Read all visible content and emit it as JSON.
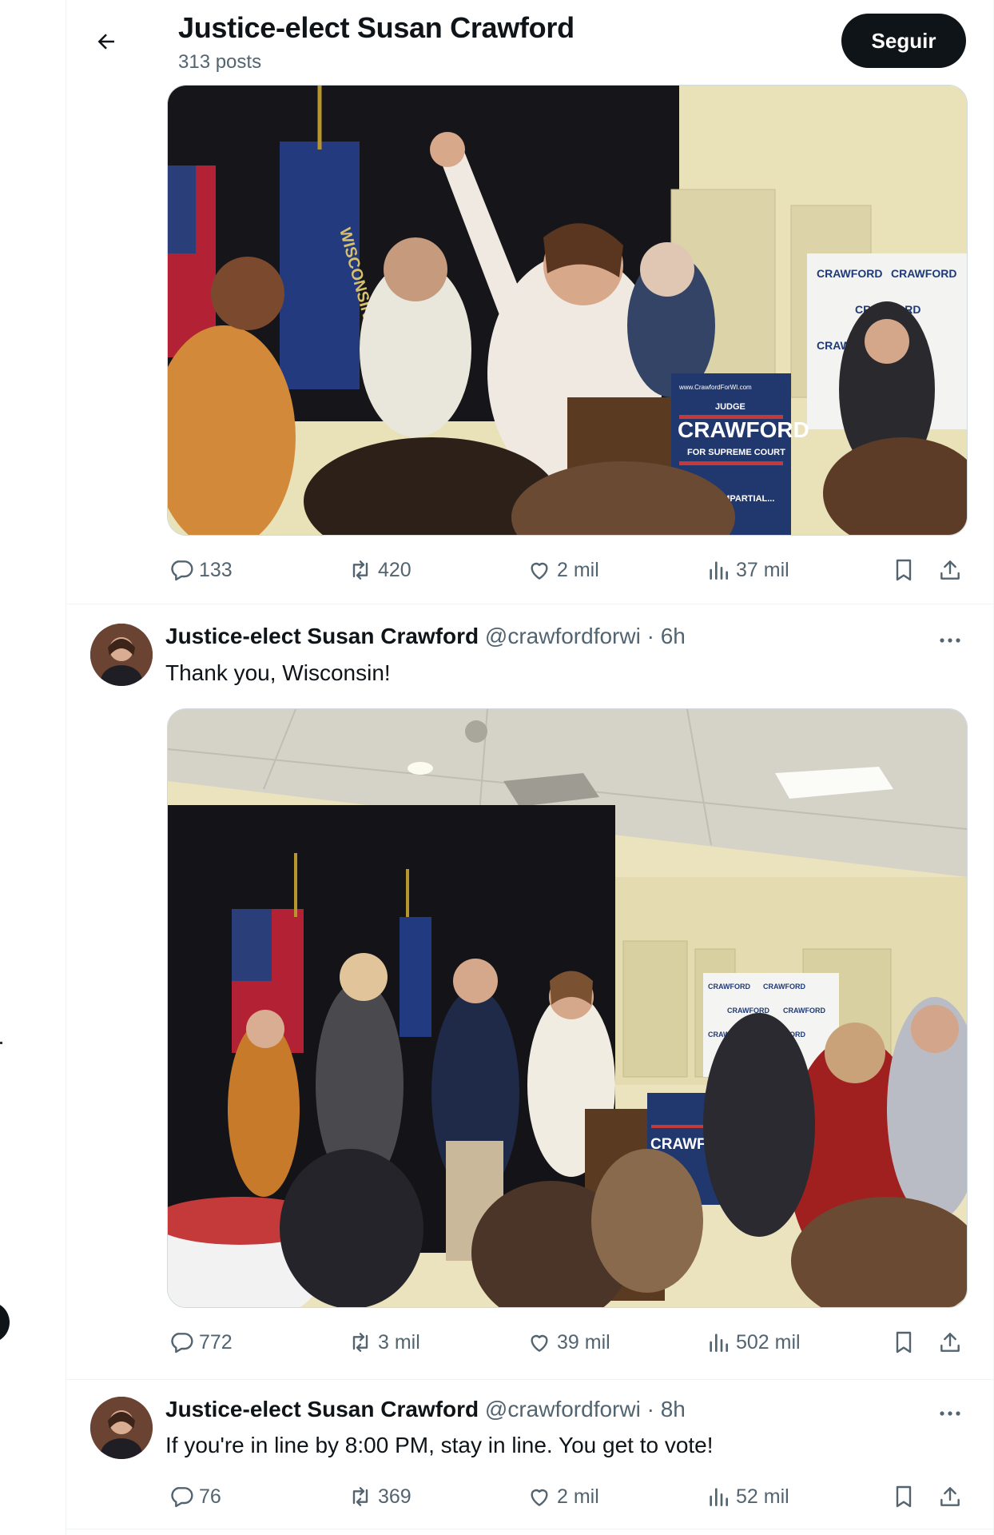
{
  "header": {
    "title": "Justice-elect Susan Crawford",
    "subtitle": "313 posts",
    "follow_label": "Seguir"
  },
  "icons": {
    "back": "arrow-left-icon",
    "reply": "reply-icon",
    "repost": "repost-icon",
    "like": "heart-icon",
    "views": "views-chart-icon",
    "bookmark": "bookmark-icon",
    "share": "share-icon",
    "more": "more-icon"
  },
  "photo_signs": {
    "sign_top": "JUDGE",
    "sign_name": "CRAWFORD",
    "sign_sub": "FOR SUPREME COURT",
    "sign_tag": "FAIR, IMPARTIAL...",
    "sign_url": "www.CrawfordForWI.com",
    "banner_word": "CRAWFORD",
    "flag_text": "WISCONSIN"
  },
  "posts": [
    {
      "stats": {
        "replies": "133",
        "reposts": "420",
        "likes": "2 mil",
        "views": "37 mil"
      }
    },
    {
      "name": "Justice-elect Susan Crawford",
      "handle": "@crawfordforwi",
      "time": "· 6h",
      "text": "Thank you, Wisconsin!",
      "stats": {
        "replies": "772",
        "reposts": "3 mil",
        "likes": "39 mil",
        "views": "502 mil"
      }
    },
    {
      "name": "Justice-elect Susan Crawford",
      "handle": "@crawfordforwi",
      "time": "· 8h",
      "text": "If you're in line by 8:00 PM, stay in line. You get to vote!",
      "stats": {
        "replies": "76",
        "reposts": "369",
        "likes": "2 mil",
        "views": "52 mil"
      }
    }
  ],
  "colors": {
    "text_primary": "#0f1419",
    "text_secondary": "#536471",
    "border": "#eff3f4",
    "follow_bg": "#0f1419"
  }
}
